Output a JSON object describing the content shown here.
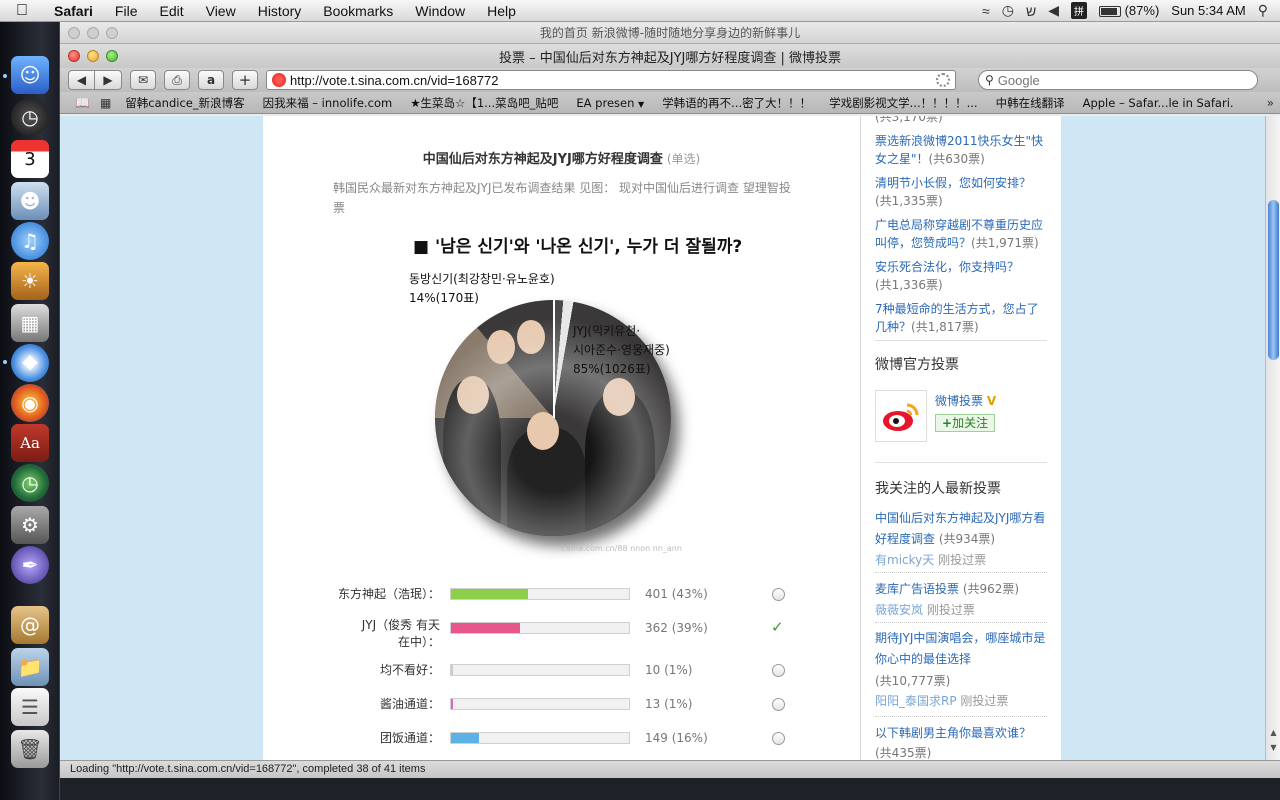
{
  "menubar": {
    "app": "Safari",
    "items": [
      "File",
      "Edit",
      "View",
      "History",
      "Bookmarks",
      "Window",
      "Help"
    ],
    "battery": "(87%)",
    "clock": "Sun 5:34 AM"
  },
  "window": {
    "back_title": "我的首页 新浪微博-随时随地分享身边的新鲜事儿",
    "title": "投票 – 中国仙后对东方神起及JYJ哪方好程度调查 | 微博投票"
  },
  "toolbar": {
    "url": "http://vote.t.sina.com.cn/vid=168772",
    "search_placeholder": "Google"
  },
  "bookmarks": [
    "留韩candice_新浪博客",
    "因我来福 – innolife.com",
    "★生菜岛☆【1...菜岛吧_贴吧",
    "EA presen",
    "学韩语的再不...密了大！！！",
    "学戏剧影视文学...！！！！...",
    "中韩在线翻译",
    "Apple – Safar...le in Safari."
  ],
  "status": "Loading \"http://vote.t.sina.com.cn/vid=168772\", completed 38 of 41 items",
  "poll": {
    "title": "中国仙后对东方神起及JYJ哪方好程度调查",
    "mode": "(单选)",
    "description": "韩国民众最新对东方神起及JYJ已发布调查结果 见图： 现对中国仙后进行调查 望理智投票",
    "image": {
      "headline": "■ '남은 신기'와 '나온 신기', 누가 더 잘될까?",
      "label_a_1": "동방신기(최강창민·유노윤호)",
      "label_a_2": "14%(170표)",
      "label_b_1": "JYJ(믹키유천·",
      "label_b_2": "시아준수·영웅재중)",
      "label_b_3": "85%(1026표)",
      "credit": "t.sina.com.cn/88 nnon nn_ann"
    },
    "options": [
      {
        "name": "东方神起（浩珉）：",
        "count": "401 (43%)",
        "pct": 43,
        "color": "#8ccf4a",
        "selected": false
      },
      {
        "name": "JYJ（俊秀 有天 在中）：",
        "count": "362 (39%)",
        "pct": 39,
        "color": "#e8578b",
        "selected": true
      },
      {
        "name": "均不看好：",
        "count": "10 (1%)",
        "pct": 1,
        "color": "#cccccc",
        "selected": false
      },
      {
        "name": "酱油通道：",
        "count": "13 (1%)",
        "pct": 1,
        "color": "#d86cc8",
        "selected": false
      },
      {
        "name": "团饭通道：",
        "count": "149 (16%)",
        "pct": 16,
        "color": "#5bb2e6",
        "selected": false
      }
    ]
  },
  "sidebar": {
    "top_partial": "(共3,170票)",
    "hot_polls": [
      {
        "title": "票选新浪微博2011快乐女生\"快女之星\"！",
        "votes": "(共630票)"
      },
      {
        "title": "清明节小长假，您如何安排？",
        "votes": "(共1,335票)"
      },
      {
        "title": "广电总局称穿越剧不尊重历史应叫停，您赞成吗？",
        "votes": "(共1,971票)"
      },
      {
        "title": "安乐死合法化，你支持吗？",
        "votes": "(共1,336票)"
      },
      {
        "title": "7种最短命的生活方式，您占了几种？",
        "votes": "(共1,817票)"
      }
    ],
    "official_heading": "微博官方投票",
    "official_name": "微博投票",
    "follow_label": "加关注",
    "following_heading": "我关注的人最新投票",
    "following": [
      {
        "title": "中国仙后对东方神起及JYJ哪方看好程度调查",
        "votes": "(共934票)",
        "user": "有micky天",
        "action": "刚投过票"
      },
      {
        "title": "麦库广告语投票",
        "votes": "(共962票)",
        "user": "薇薇安岚",
        "action": "刚投过票"
      },
      {
        "title": "期待JYJ中国演唱会，哪座城市是你心中的最佳选择",
        "votes": "(共10,777票)",
        "user": "阳阳_泰国求RP",
        "action": "刚投过票"
      },
      {
        "title": "以下韩剧男主角你最喜欢谁？",
        "votes": "(共435票)"
      }
    ]
  }
}
